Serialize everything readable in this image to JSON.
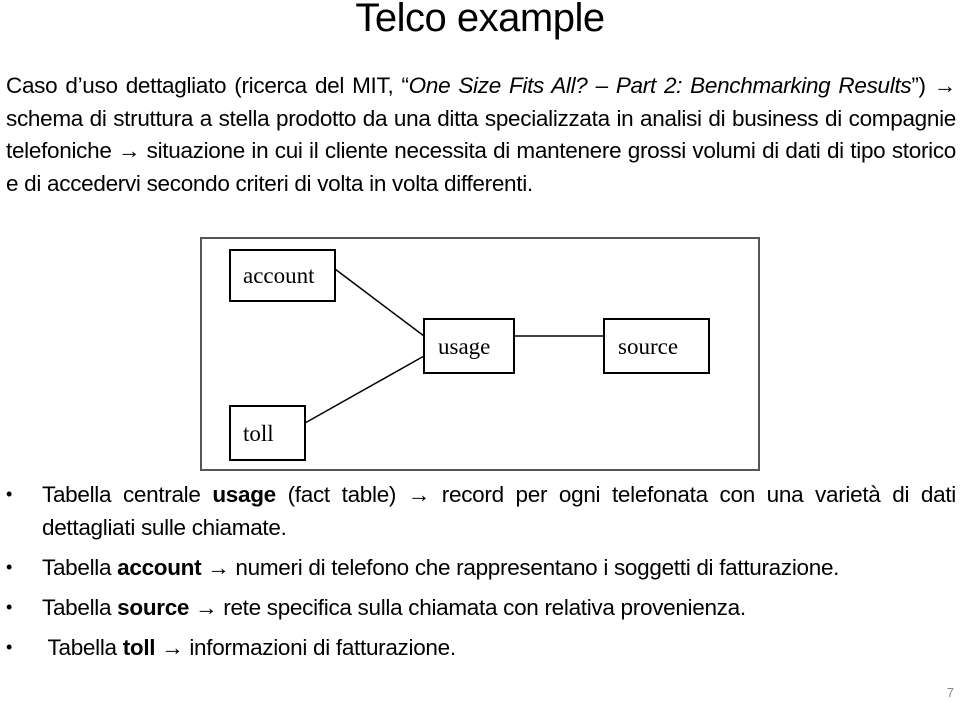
{
  "slide": {
    "title": "Telco example",
    "page_number": "7"
  },
  "intro": {
    "p1": "Caso d’uso dettagliato  (ricerca del MIT, “",
    "p2_italic": "One Size Fits All? – Part 2: Benchmarking Results",
    "p3": "”) ",
    "arrow": "→",
    "p4": " schema di struttura a stella prodotto da una ditta specializzata in analisi di business di compagnie telefoniche ",
    "p5": " situazione in cui il cliente necessita di mantenere grossi volumi di dati di tipo storico e di accedervi secondo criteri di volta in volta differenti."
  },
  "diagram": {
    "nodes": [
      {
        "id": "account",
        "label": "account"
      },
      {
        "id": "usage",
        "label": "usage"
      },
      {
        "id": "source",
        "label": "source"
      },
      {
        "id": "toll",
        "label": "toll"
      }
    ],
    "edges": [
      {
        "from": "account",
        "to": "usage"
      },
      {
        "from": "toll",
        "to": "usage"
      },
      {
        "from": "usage",
        "to": "source"
      }
    ]
  },
  "bullets": [
    {
      "prefix": "Tabella centrale ",
      "bold": "usage",
      "middle": " (fact table) ",
      "arrow": "→",
      "text": " record per ogni telefonata con una varietà di dati dettagliati sulle chiamate."
    },
    {
      "prefix": "Tabella ",
      "bold": "account",
      "middle": " ",
      "arrow": "→",
      "text": " numeri di telefono che rappresentano i soggetti di fatturazione."
    },
    {
      "prefix": "Tabella ",
      "bold": "source",
      "middle": " ",
      "arrow": "→",
      "text": " rete specifica sulla chiamata con relativa provenienza."
    },
    {
      "prefix": " Tabella ",
      "bold": "toll",
      "middle": " ",
      "arrow": "→",
      "text": " informazioni di fatturazione."
    }
  ],
  "bullet_glyph": "•"
}
